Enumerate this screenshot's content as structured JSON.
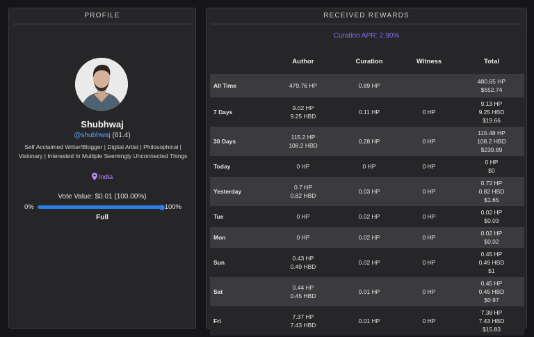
{
  "profile": {
    "section_title": "PROFILE",
    "name": "Shubhwaj",
    "handle": "@shubhwaj",
    "reputation": "(61.4)",
    "bio": "Self Acclaimed Writer/Blogger | Digital Artist | Philosophical | Visionary | Interested In Multiple Seemingly Unconnected Things",
    "location": "India",
    "vote_value_label": "Vote Value: $0.01 (100.00%)",
    "slider_min": "0%",
    "slider_max": "100%",
    "slider_value_percent": 100,
    "vote_state": "Full"
  },
  "rewards": {
    "section_title": "RECEIVED REWARDS",
    "curation_apr": "Curation APR: 2.90%",
    "columns": [
      "",
      "Author",
      "Curation",
      "Witness",
      "Total"
    ],
    "rows": [
      {
        "label": "All Time",
        "author": [
          "479.76 HP"
        ],
        "curation": "0.89 HP",
        "witness": "",
        "total": [
          "480.65 HP",
          "$552.74"
        ]
      },
      {
        "label": "7 Days",
        "author": [
          "9.02 HP",
          "9.25 HBD"
        ],
        "curation": "0.11 HP",
        "witness": "0 HP",
        "total": [
          "9.13 HP",
          "9.25 HBD",
          "$19.66"
        ]
      },
      {
        "label": "30 Days",
        "author": [
          "115.2 HP",
          "108.2 HBD"
        ],
        "curation": "0.28 HP",
        "witness": "0 HP",
        "total": [
          "115.48 HP",
          "108.2 HBD",
          "$239.89"
        ]
      },
      {
        "label": "Today",
        "author": [
          "0 HP"
        ],
        "curation": "0 HP",
        "witness": "0 HP",
        "total": [
          "0 HP",
          "$0"
        ]
      },
      {
        "label": "Yesterday",
        "author": [
          "0.7 HP",
          "0.82 HBD"
        ],
        "curation": "0.03 HP",
        "witness": "0 HP",
        "total": [
          "0.72 HP",
          "0.82 HBD",
          "$1.65"
        ]
      },
      {
        "label": "Tue",
        "author": [
          "0 HP"
        ],
        "curation": "0.02 HP",
        "witness": "0 HP",
        "total": [
          "0.02 HP",
          "$0.03"
        ]
      },
      {
        "label": "Mon",
        "author": [
          "0 HP"
        ],
        "curation": "0.02 HP",
        "witness": "0 HP",
        "total": [
          "0.02 HP",
          "$0.02"
        ]
      },
      {
        "label": "Sun",
        "author": [
          "0.43 HP",
          "0.49 HBD"
        ],
        "curation": "0.02 HP",
        "witness": "0 HP",
        "total": [
          "0.45 HP",
          "0.49 HBD",
          "$1"
        ]
      },
      {
        "label": "Sat",
        "author": [
          "0.44 HP",
          "0.45 HBD"
        ],
        "curation": "0.01 HP",
        "witness": "0 HP",
        "total": [
          "0.45 HP",
          "0.45 HBD",
          "$0.97"
        ]
      },
      {
        "label": "Fri",
        "author": [
          "7.37 HP",
          "7.43 HBD"
        ],
        "curation": "0.01 HP",
        "witness": "0 HP",
        "total": [
          "7.38 HP",
          "7.43 HBD",
          "$15.83"
        ]
      }
    ]
  },
  "colors": {
    "accent_blue": "#2a7de1",
    "link_blue": "#5ba7ff",
    "apr_purple": "#7d6cf5",
    "location_purple": "#b98bff",
    "panel_bg": "#262628",
    "row_alt_bg": "#3b3b3e"
  },
  "icons": {
    "location": "map-pin-icon"
  }
}
